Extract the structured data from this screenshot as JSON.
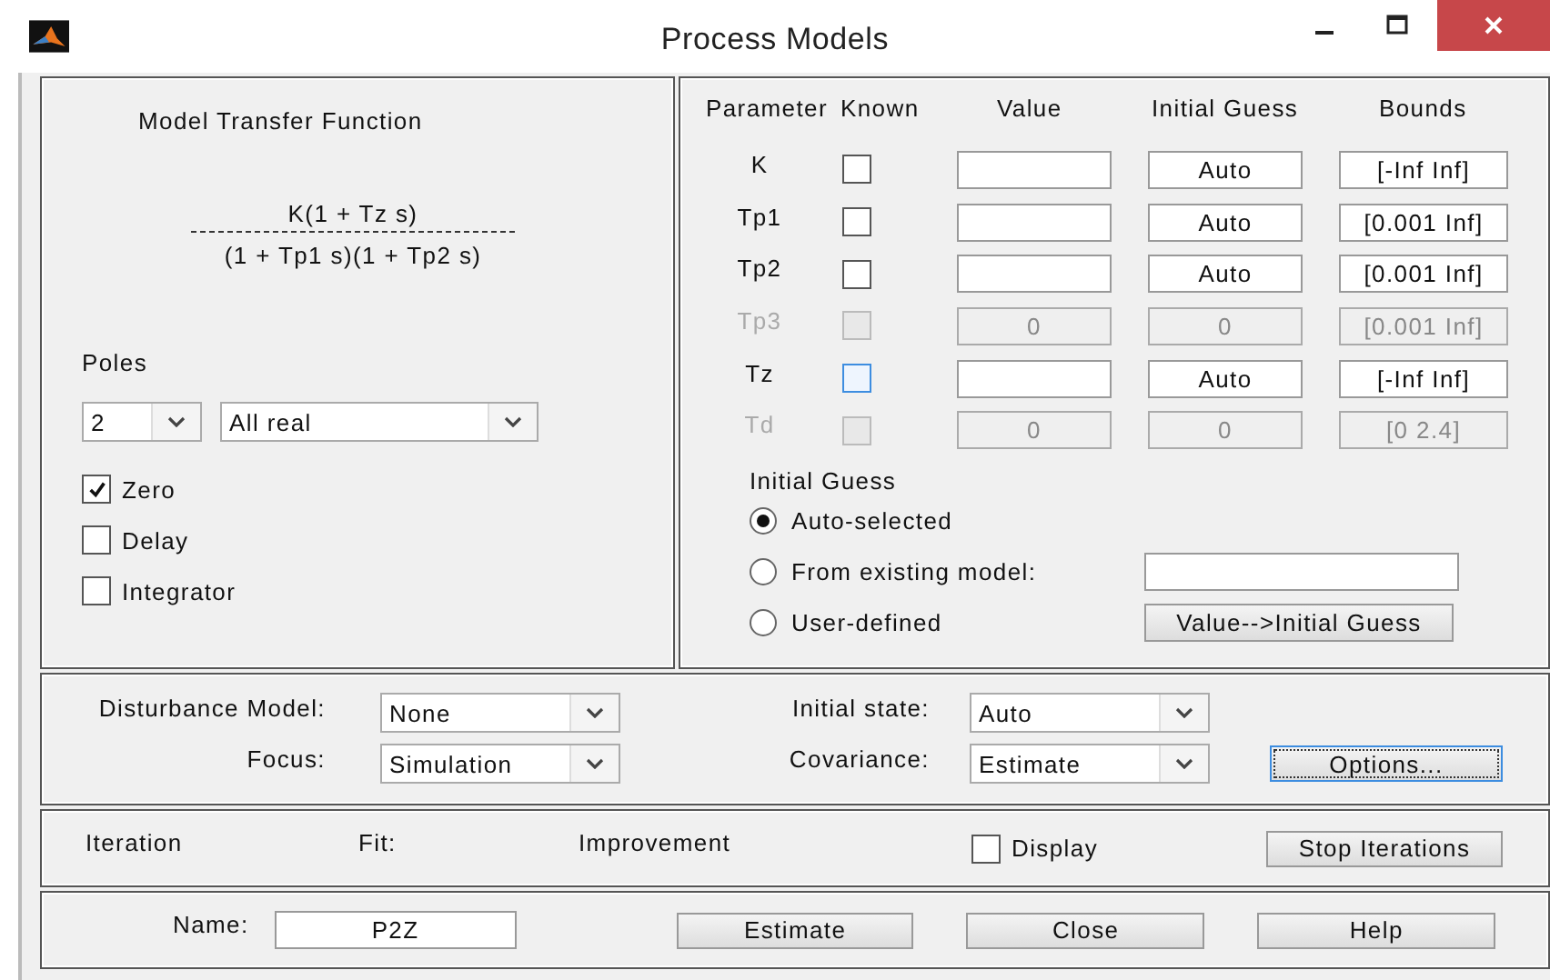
{
  "window": {
    "title": "Process Models"
  },
  "transfer_function": {
    "title": "Model Transfer Function",
    "numerator": "K(1 + Tz s)",
    "denominator": "(1 + Tp1 s)(1 + Tp2 s)"
  },
  "poles": {
    "label": "Poles",
    "order": "2",
    "type": "All real"
  },
  "structure_options": [
    {
      "label": "Zero",
      "checked": true
    },
    {
      "label": "Delay",
      "checked": false
    },
    {
      "label": "Integrator",
      "checked": false
    }
  ],
  "parameters": {
    "columns": [
      "Parameter",
      "Known",
      "Value",
      "Initial Guess",
      "Bounds"
    ],
    "rows": [
      {
        "name": "K",
        "known": false,
        "enabled": true,
        "focused": false,
        "initial_guess": "Auto",
        "bounds": "[-Inf Inf]"
      },
      {
        "name": "Tp1",
        "known": false,
        "enabled": true,
        "focused": false,
        "initial_guess": "Auto",
        "bounds": "[0.001 Inf]"
      },
      {
        "name": "Tp2",
        "known": false,
        "enabled": true,
        "focused": false,
        "initial_guess": "Auto",
        "bounds": "[0.001 Inf]"
      },
      {
        "name": "Tp3",
        "known": false,
        "enabled": false,
        "focused": false,
        "value": "0",
        "initial_guess": "0",
        "bounds": "[0.001 Inf]"
      },
      {
        "name": "Tz",
        "known": false,
        "enabled": true,
        "focused": true,
        "initial_guess": "Auto",
        "bounds": "[-Inf Inf]"
      },
      {
        "name": "Td",
        "known": false,
        "enabled": false,
        "focused": false,
        "value": "0",
        "initial_guess": "0",
        "bounds": "[0 2.4]"
      }
    ]
  },
  "initial_guess": {
    "title": "Initial Guess",
    "options": [
      {
        "label": "Auto-selected",
        "selected": true,
        "kind": "plain"
      },
      {
        "label": "From existing model:",
        "selected": false,
        "kind": "field"
      },
      {
        "label": "User-defined",
        "selected": false,
        "kind": "button",
        "button": "Value-->Initial Guess"
      }
    ]
  },
  "settings": [
    {
      "label": "Disturbance Model:",
      "value": "None"
    },
    {
      "label": "Initial state:",
      "value": "Auto"
    },
    {
      "label": "Focus:",
      "value": "Simulation"
    },
    {
      "label": "Covariance:",
      "value": "Estimate"
    }
  ],
  "options_button": {
    "label": "Options...",
    "focused": true
  },
  "iteration": {
    "labels": [
      "Iteration",
      "Fit:",
      "Improvement"
    ],
    "display": {
      "label": "Display",
      "checked": false
    },
    "button": "Stop Iterations"
  },
  "footer": {
    "name_label": "Name:",
    "name_value": "P2Z",
    "buttons": [
      "Estimate",
      "Close",
      "Help"
    ]
  }
}
